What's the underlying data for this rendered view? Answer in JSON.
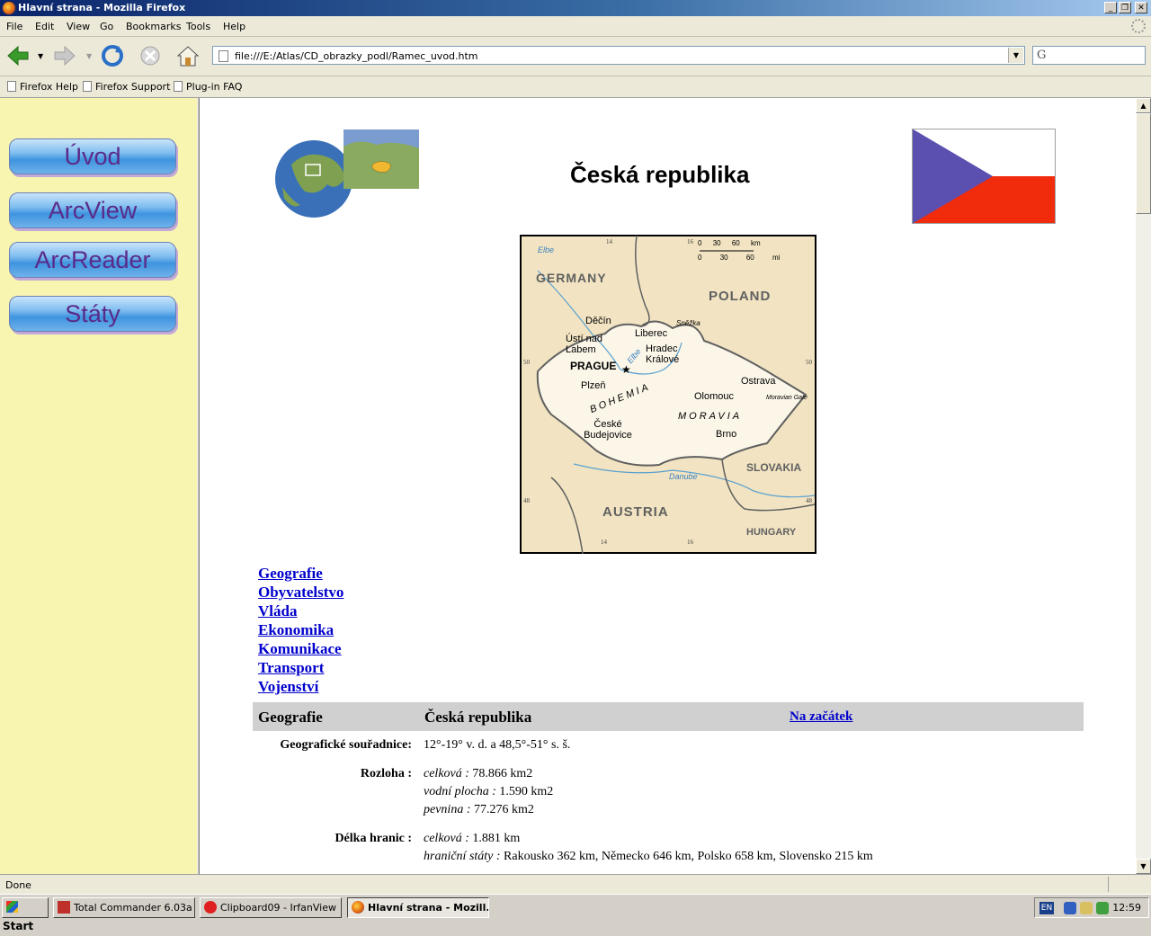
{
  "window": {
    "title": "Hlavní strana - Mozilla Firefox"
  },
  "menubar": {
    "items": [
      "File",
      "Edit",
      "View",
      "Go",
      "Bookmarks",
      "Tools",
      "Help"
    ]
  },
  "navbar": {
    "url": "file:///E:/Atlas/CD_obrazky_podl/Ramec_uvod.htm"
  },
  "bookmarks": [
    "Firefox Help",
    "Firefox Support",
    "Plug-in FAQ"
  ],
  "sidebar": {
    "buttons": [
      "Úvod",
      "ArcView",
      "ArcReader",
      "Státy"
    ]
  },
  "main": {
    "title": "Česká republika",
    "map": {
      "countries": [
        "GERMANY",
        "POLAND",
        "SLOVAKIA",
        "AUSTRIA",
        "HUNGARY"
      ],
      "regions": [
        "BOHEMIA",
        "MORAVIA"
      ],
      "capital": "PRAGUE",
      "cities": [
        "Děčín",
        "Ústí nad Labem",
        "Liberec",
        "Hradec Králové",
        "Plzeň",
        "Olomouc",
        "Ostrava",
        "České Budejovice",
        "Brno"
      ],
      "features": [
        "Sněžka",
        "Moravian Gate",
        "Elbe",
        "Elbe",
        "Danube"
      ],
      "scale_top": [
        "0",
        "30",
        "60 km"
      ],
      "scale_bottom": [
        "0",
        "30",
        "60 mi"
      ],
      "ticks": [
        "14",
        "16",
        "14",
        "16",
        "50",
        "48",
        "50",
        "48"
      ]
    },
    "toc": [
      "Geografie",
      "Obyvatelstvo",
      "Vláda",
      "Ekonomika",
      "Komunikace",
      "Transport",
      "Vojenství"
    ],
    "section": {
      "header": {
        "col1": "Geografie",
        "col2": "Česká republika",
        "link": "Na začátek"
      },
      "rows": [
        {
          "label": "Geografické souřadnice:",
          "value": "12°-19° v. d. a 48,5°-51° s. š."
        },
        {
          "label": "Rozloha :",
          "lines": [
            {
              "key": "celková :",
              "val": " 78.866 km2"
            },
            {
              "key": "vodní plocha :",
              "val": " 1.590 km2"
            },
            {
              "key": "pevnina :",
              "val": " 77.276 km2"
            }
          ]
        },
        {
          "label": "Délka hranic :",
          "lines": [
            {
              "key": "celková :",
              "val": " 1.881 km"
            },
            {
              "key": "hraniční státy :",
              "val": " Rakousko 362 km, Německo 646 km, Polsko 658 km, Slovensko 215 km"
            }
          ]
        }
      ]
    }
  },
  "statusbar": {
    "text": "Done"
  },
  "taskbar": {
    "start": "Start",
    "tasks": [
      "Total Commander 6.03a ...",
      "Clipboard09 - IrfanView",
      "Hlavní strana - Mozill..."
    ],
    "lang": "EN",
    "clock": "12:59"
  },
  "colors": {
    "sidebar_bg": "#f7f5b0",
    "link": "#0000cc",
    "flag_blue": "#5b4fb0",
    "flag_red": "#f02c0c",
    "map_land": "#f2e4c2",
    "map_cz": "#fbf6e8"
  }
}
